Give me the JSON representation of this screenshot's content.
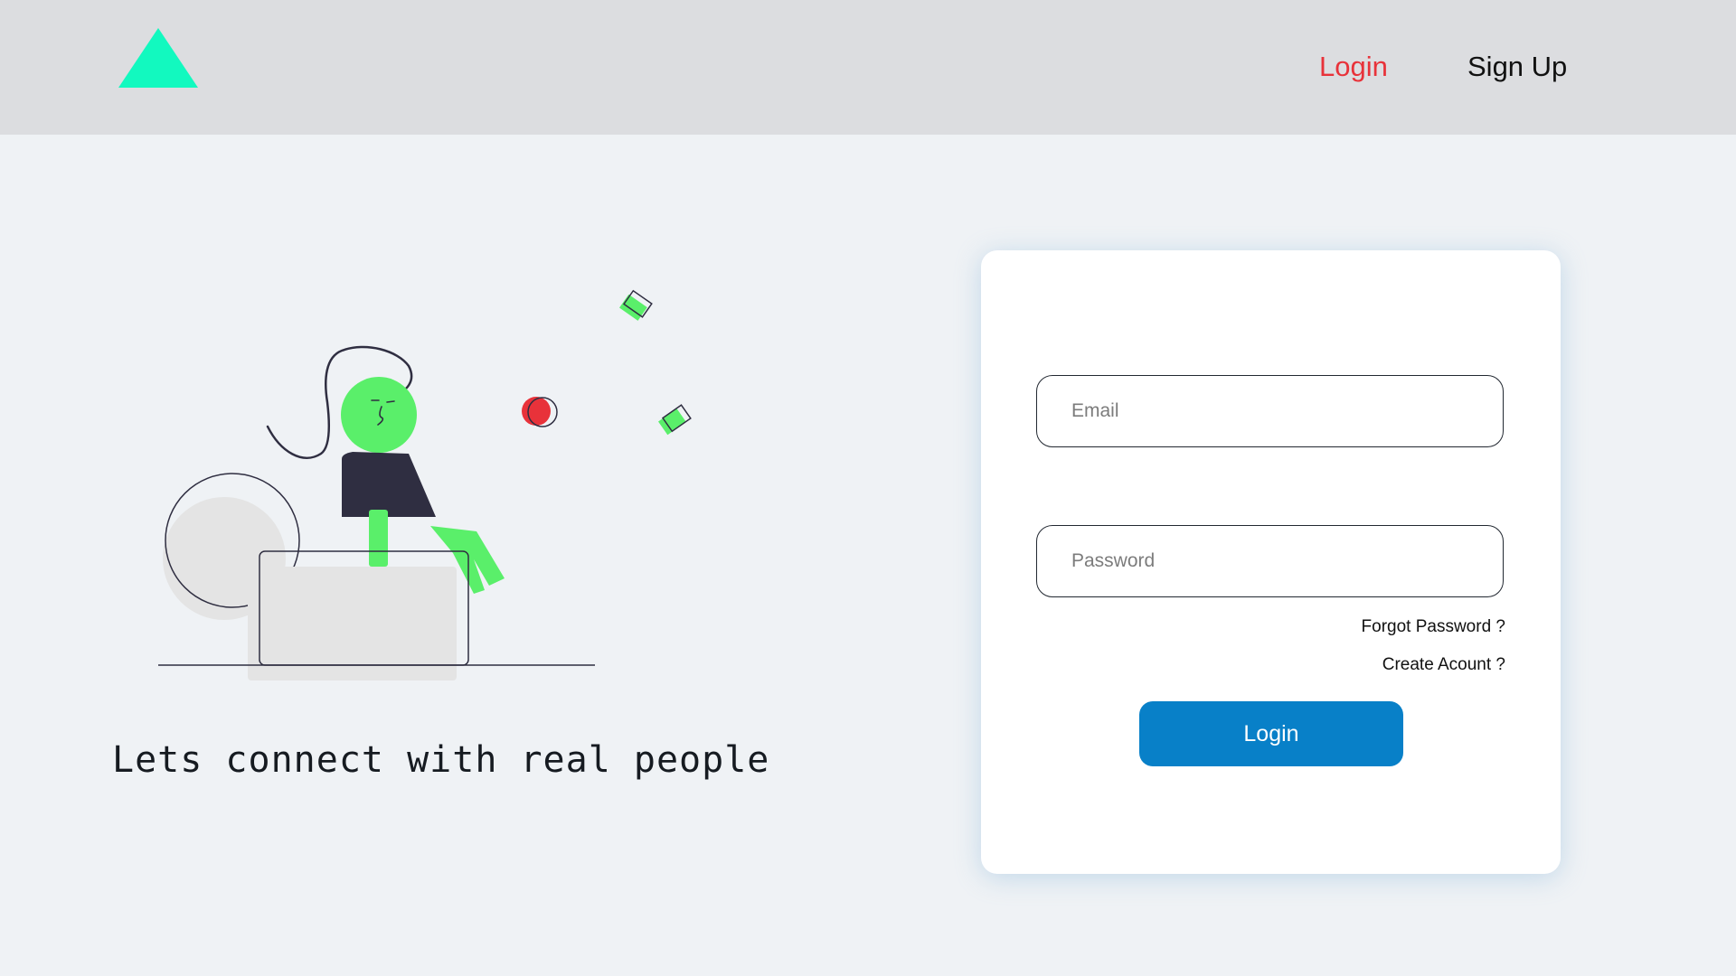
{
  "header": {
    "logo": "triangle-logo",
    "nav": {
      "login_label": "Login",
      "signup_label": "Sign Up"
    }
  },
  "hero": {
    "tagline": "Lets connect with real people"
  },
  "login_form": {
    "email_placeholder": "Email",
    "password_placeholder": "Password",
    "forgot_password_label": "Forgot Password ?",
    "create_account_label": "Create Acount ?",
    "submit_label": "Login"
  },
  "colors": {
    "accent_red": "#e8323a",
    "accent_green": "#5aef6a",
    "logo_teal": "#12f9bf",
    "primary_blue": "#0880c8",
    "header_bg": "#dcdde0",
    "page_bg": "#eff2f5"
  }
}
